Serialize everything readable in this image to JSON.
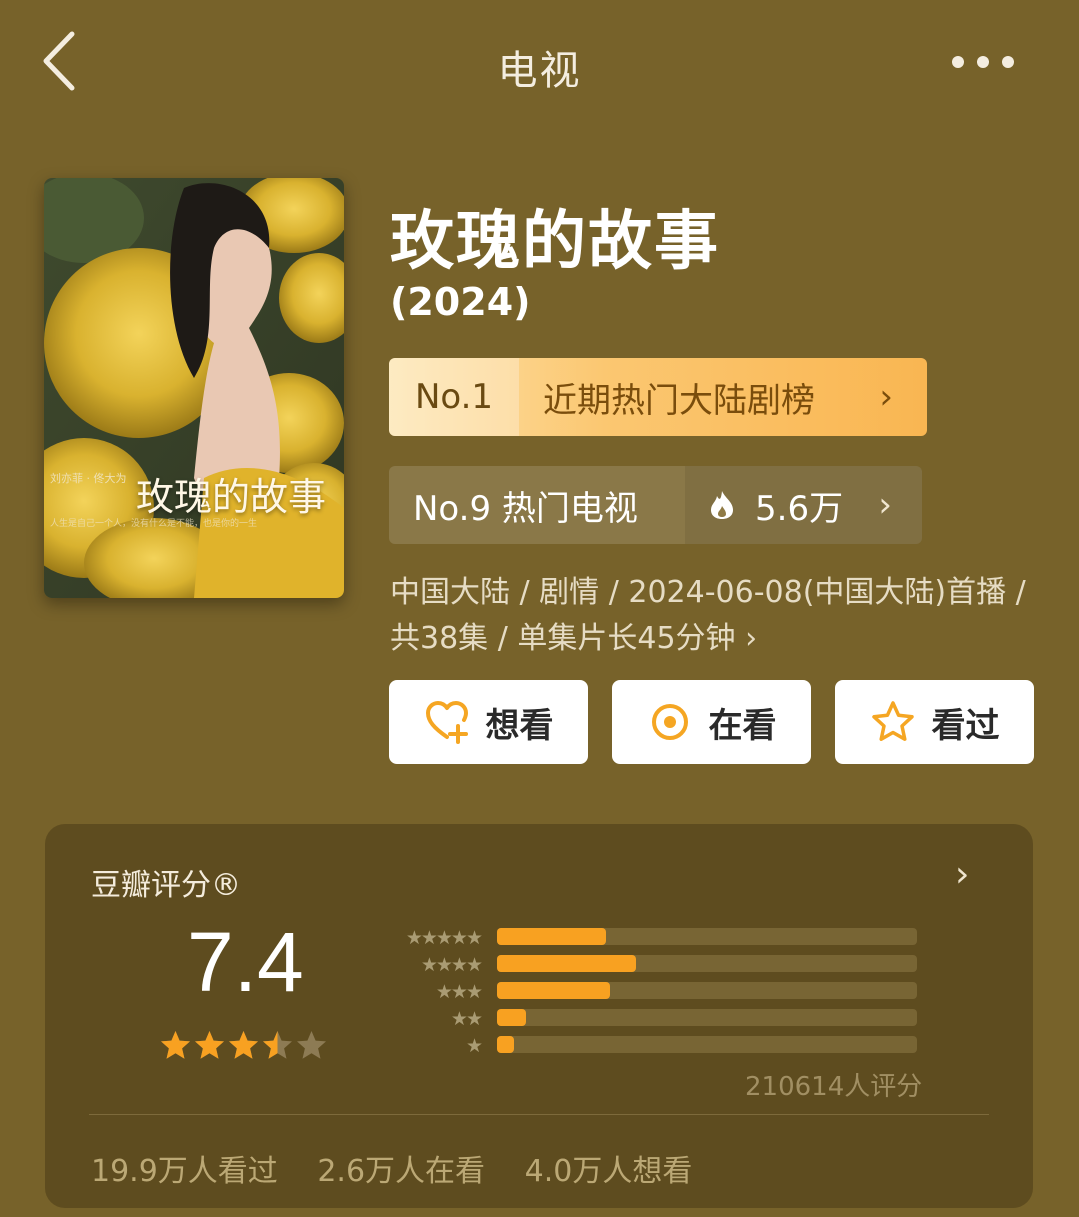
{
  "header": {
    "title": "电视",
    "back_icon": "chevron-left-icon",
    "more_icon": "more-dots-icon"
  },
  "poster": {
    "title_text": "玫瑰的故事",
    "credits": "刘亦菲 · 佟大为",
    "tagline": "人生是自己一个人，没有什么是不能，也是你的一生"
  },
  "show": {
    "title": "玫瑰的故事",
    "year": "(2024)"
  },
  "rank_primary": {
    "rank": "No.1",
    "label": "近期热门大陆剧榜",
    "chevron": "›"
  },
  "rank_secondary": {
    "label": "No.9 热门电视",
    "heat": "5.6万",
    "heat_icon": "flame-icon",
    "chevron": "›"
  },
  "meta": {
    "line": "中国大陆 / 剧情 / 2024-06-08(中国大陆)首播 / 共38集 / 单集片长45分钟 ›"
  },
  "actions": {
    "want": "想看",
    "watching": "在看",
    "watched": "看过"
  },
  "rating": {
    "title": "豆瓣评分®",
    "score": "7.4",
    "stars_filled": 3.5,
    "stars_total": 5,
    "distribution": [
      {
        "stars": "★★★★★",
        "fraction": 0.26
      },
      {
        "stars": "★★★★",
        "fraction": 0.33
      },
      {
        "stars": "★★★",
        "fraction": 0.27
      },
      {
        "stars": "★★",
        "fraction": 0.07
      },
      {
        "stars": "★",
        "fraction": 0.04
      }
    ],
    "count": "210614人评分",
    "chevron": "›"
  },
  "stats": {
    "watched": "19.9万人看过",
    "watching": "2.6万人在看",
    "want": "4.0万人想看"
  },
  "colors": {
    "background": "#77622a",
    "accent_orange": "#f8a121",
    "rank_gold": "#fbc771"
  }
}
